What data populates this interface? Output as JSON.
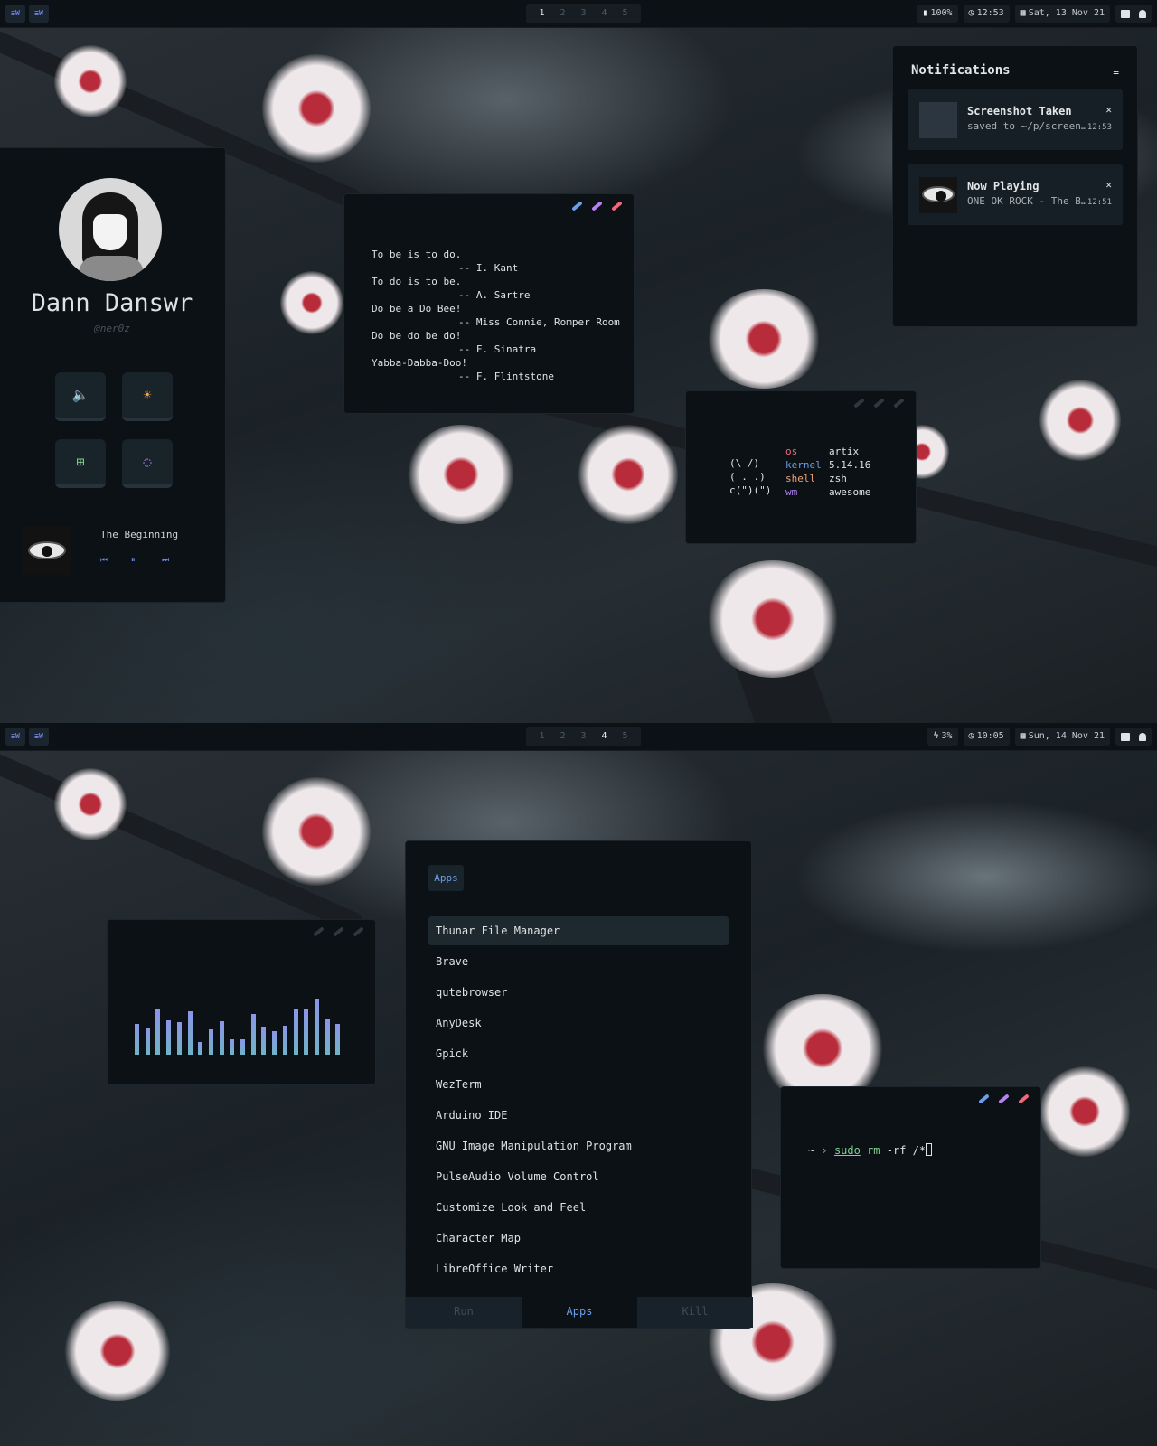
{
  "colors": {
    "accent_blue": "#6d9ee8",
    "accent_purple": "#b483f0",
    "accent_red": "#f0697a",
    "accent_green": "#7fd08e",
    "accent_orange": "#f5a24b",
    "panel_bg": "#0b1115"
  },
  "screen1": {
    "bar": {
      "tags": [
        "≡W",
        "≡W"
      ],
      "workspaces": [
        "1",
        "2",
        "3",
        "4",
        "5"
      ],
      "active_workspace": 1,
      "battery": "100%",
      "clock": "12:53",
      "date": "Sat, 13 Nov 21",
      "icons": [
        "chat-icon",
        "bell-icon"
      ]
    },
    "profile": {
      "name": "Dann Danswr",
      "username": "@ner0z",
      "buttons": [
        {
          "icon": "volume-icon",
          "glyph": "🔈",
          "color": "#6d9ee8"
        },
        {
          "icon": "brightness-icon",
          "glyph": "☀",
          "color": "#f5a24b"
        },
        {
          "icon": "cpu-icon",
          "glyph": "⊞",
          "color": "#7fd08e"
        },
        {
          "icon": "refresh-icon",
          "glyph": "◌",
          "color": "#b483f0"
        }
      ],
      "song": "The Beginning",
      "controls": {
        "prev": "⏮",
        "pause": "⏸",
        "next": "⏭"
      }
    },
    "quotes": {
      "lines": [
        {
          "text": "To be is to do."
        },
        {
          "text": "-- I. Kant"
        },
        {
          "text": "To do is to be."
        },
        {
          "text": "-- A. Sartre"
        },
        {
          "text": "Do be a Do Bee!"
        },
        {
          "text": "-- Miss Connie, Romper Room"
        },
        {
          "text": "Do be do be do!"
        },
        {
          "text": "-- F. Sinatra"
        },
        {
          "text": "Yabba-Dabba-Doo!"
        },
        {
          "text": "-- F. Flintstone"
        }
      ]
    },
    "fetch": {
      "ascii": "(\\ /)\n( . .)\nc(\")(\")",
      "rows": [
        {
          "key": "os",
          "value": "artix",
          "color": "#f0697a"
        },
        {
          "key": "kernel",
          "value": "5.14.16",
          "color": "#6d9ee8"
        },
        {
          "key": "shell",
          "value": "zsh",
          "color": "#f0a37a"
        },
        {
          "key": "wm",
          "value": "awesome",
          "color": "#b483f0"
        }
      ]
    },
    "notifications": {
      "title": "Notifications",
      "items": [
        {
          "title": "Screenshot Taken",
          "body": "saved to ~/p/screen…",
          "time": "12:53",
          "close": "✕"
        },
        {
          "title": "Now Playing",
          "body": "ONE OK ROCK - The B…",
          "time": "12:51",
          "close": "✕"
        }
      ]
    }
  },
  "screen2": {
    "bar": {
      "tags": [
        "≡W",
        "≡W"
      ],
      "workspaces": [
        "1",
        "2",
        "3",
        "4",
        "5"
      ],
      "active_workspace": 4,
      "battery": "3%",
      "clock": "10:05",
      "date": "Sun, 14 Nov 21",
      "icons": [
        "chat-icon",
        "bell-icon"
      ]
    },
    "visualizer": {
      "levels": [
        0.55,
        0.48,
        0.8,
        0.62,
        0.58,
        0.78,
        0.22,
        0.45,
        0.6,
        0.28,
        0.28,
        0.72,
        0.5,
        0.42,
        0.52,
        0.82,
        0.8,
        1.0,
        0.65,
        0.55
      ]
    },
    "launcher": {
      "header_tab": "Apps",
      "items": [
        "Thunar File Manager",
        "Brave",
        "qutebrowser",
        "AnyDesk",
        "Gpick",
        "WezTerm",
        "Arduino IDE",
        "GNU Image Manipulation Program",
        "PulseAudio Volume Control",
        "Customize Look and Feel",
        "Character Map",
        "LibreOffice Writer"
      ],
      "selected_index": 0,
      "modes": [
        "Run",
        "Apps",
        "Kill"
      ],
      "active_mode": 1
    },
    "terminal": {
      "cwd": "~",
      "arrow": "›",
      "cmd": "sudo",
      "arg1": "rm",
      "arg2": "-rf /*"
    }
  }
}
